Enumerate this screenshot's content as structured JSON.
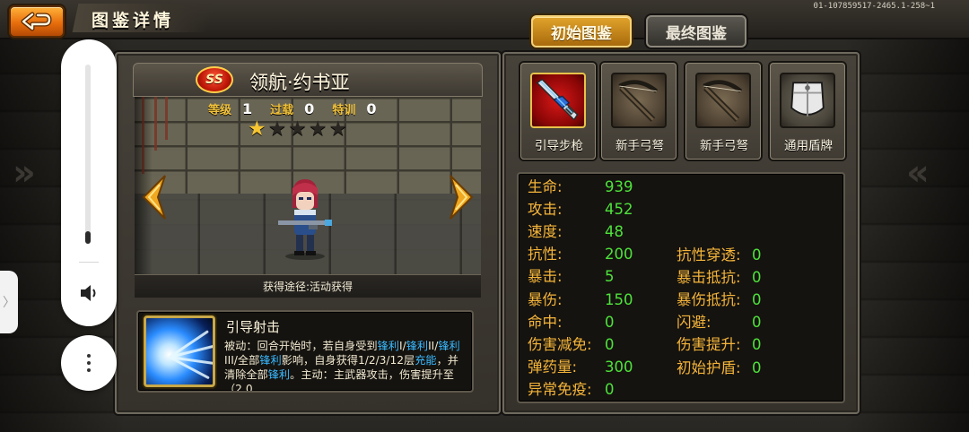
{
  "header": {
    "title": "图鉴详情",
    "build_id": "01-107859517-2465.1-258~1"
  },
  "tabs": [
    {
      "label": "初始图鉴",
      "active": true
    },
    {
      "label": "最终图鉴",
      "active": false
    }
  ],
  "hero": {
    "rank": "SS",
    "name": "领航·约书亚",
    "level_label": "等级",
    "level": "1",
    "overload_label": "过载",
    "overload": "0",
    "training_label": "特训",
    "training": "0",
    "stars_total": 5,
    "stars_filled": 1,
    "source": "获得途径:活动获得"
  },
  "skill": {
    "name": "引导射击",
    "desc_parts": [
      {
        "t": "被动：回合开始时，若自身受到",
        "k": false
      },
      {
        "t": "锋利",
        "k": true
      },
      {
        "t": "I/",
        "k": false
      },
      {
        "t": "锋利",
        "k": true
      },
      {
        "t": "II/",
        "k": false
      },
      {
        "t": "锋利",
        "k": true
      },
      {
        "t": "III/全部",
        "k": false
      },
      {
        "t": "锋利",
        "k": true
      },
      {
        "t": "影响，自身获得1/2/3/12层",
        "k": false
      },
      {
        "t": "充能",
        "k": true
      },
      {
        "t": "，并清除全部",
        "k": false
      },
      {
        "t": "锋利",
        "k": true
      },
      {
        "t": "。",
        "k": false
      },
      {
        "t": "主动：主武器攻击，伤害提升至（2.0",
        "k": false
      }
    ]
  },
  "equipment": [
    {
      "label": "引导步枪",
      "icon": "rifle"
    },
    {
      "label": "新手弓弩",
      "icon": "xbow"
    },
    {
      "label": "新手弓弩",
      "icon": "xbow"
    },
    {
      "label": "通用盾牌",
      "icon": "shield"
    }
  ],
  "stats_left": [
    {
      "label": "生命:",
      "value": "939"
    },
    {
      "label": "攻击:",
      "value": "452"
    },
    {
      "label": "速度:",
      "value": "48"
    },
    {
      "label": "抗性:",
      "value": "200"
    },
    {
      "label": "暴击:",
      "value": "5"
    },
    {
      "label": "暴伤:",
      "value": "150"
    },
    {
      "label": "命中:",
      "value": "0"
    },
    {
      "label": "伤害减免:",
      "value": "0"
    },
    {
      "label": "弹药量:",
      "value": "300"
    },
    {
      "label": "异常免疫:",
      "value": "0"
    }
  ],
  "stats_right": [
    {
      "label": "抗性穿透:",
      "value": "0"
    },
    {
      "label": "暴击抵抗:",
      "value": "0"
    },
    {
      "label": "暴伤抵抗:",
      "value": "0"
    },
    {
      "label": "闪避:",
      "value": "0"
    },
    {
      "label": "伤害提升:",
      "value": "0"
    },
    {
      "label": "初始护盾:",
      "value": "0"
    }
  ],
  "system_overlay": {
    "volume_level": 0.07
  },
  "colors": {
    "stat_label": "#f4b43a",
    "stat_value": "#4ee23c",
    "keyword": "#38b8ff",
    "star_on": "#f6c531"
  }
}
